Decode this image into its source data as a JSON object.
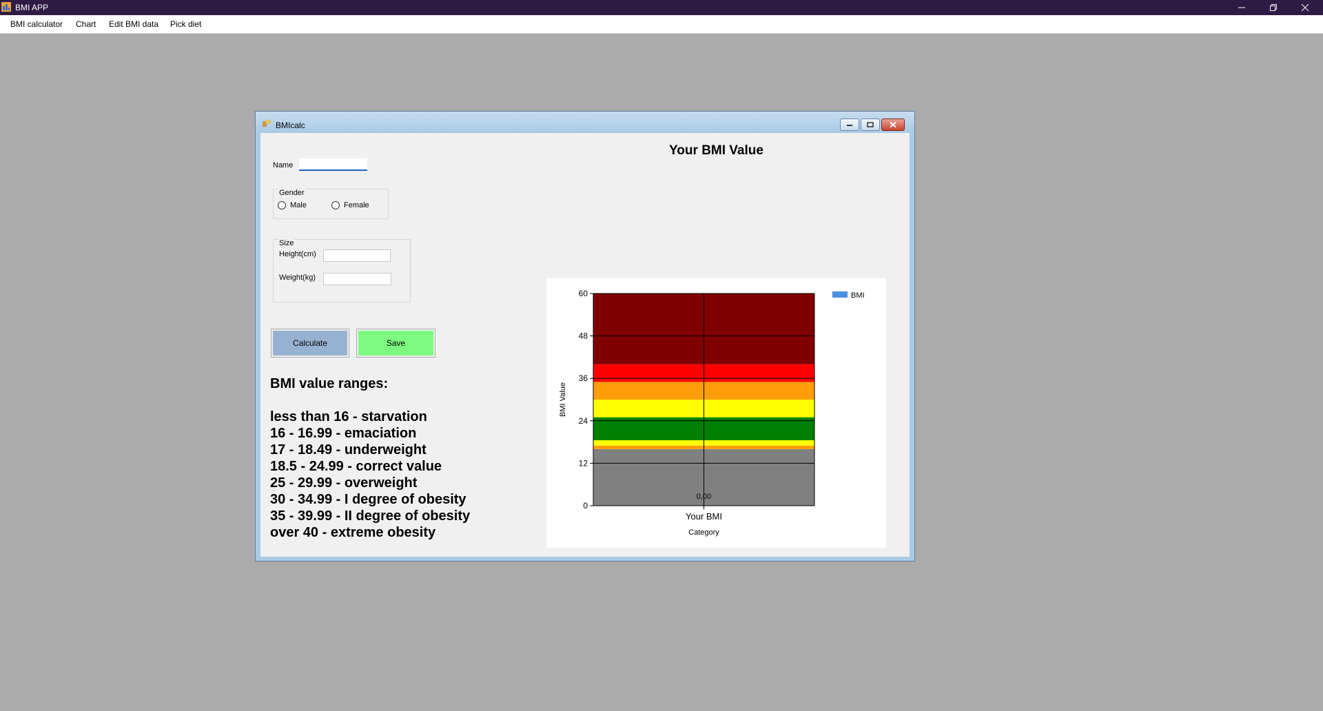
{
  "app": {
    "title": "BMI APP",
    "menu": [
      "BMI calculator",
      "Chart",
      "Edit BMI data",
      "Pick diet"
    ]
  },
  "child": {
    "title": "BMIcalc",
    "name_label": "Name",
    "name_value": "",
    "gender": {
      "title": "Gender",
      "male": "Male",
      "female": "Female"
    },
    "size": {
      "title": "Size",
      "height_label": "Height(cm)",
      "height_value": "",
      "weight_label": "Weight(kg)",
      "weight_value": ""
    },
    "calculate_label": "Calculate",
    "save_label": "Save",
    "calculate_color": "#97b1d0",
    "save_color": "#7dfb80",
    "ranges_title": "BMI value ranges:",
    "ranges": [
      "less than 16 - starvation",
      "16 - 16.99 - emaciation",
      "17 - 18.49 - underweight",
      "18.5 - 24.99 - correct value",
      "25 - 29.99 - overweight",
      "30 - 34.99 - I degree of obesity",
      "35 - 39.99 - II degree of obesity",
      "over 40 - extreme obesity"
    ],
    "chart_heading": "Your BMI Value"
  },
  "chart_data": {
    "type": "bar",
    "categories": [
      "Your BMI"
    ],
    "series": [
      {
        "name": "BMI",
        "values": [
          0
        ],
        "color": "#4a90e2"
      }
    ],
    "data_labels": [
      "0,00"
    ],
    "xlabel": "Category",
    "ylabel": "BMI Value",
    "ylim": [
      0,
      60
    ],
    "yticks": [
      0,
      12,
      24,
      36,
      48,
      60
    ],
    "grid": true,
    "legend": "top-right",
    "bands": [
      {
        "from": 0,
        "to": 16,
        "color": "#808080"
      },
      {
        "from": 16,
        "to": 17,
        "color": "#ff9e0a"
      },
      {
        "from": 17,
        "to": 18.5,
        "color": "#ffff00"
      },
      {
        "from": 18.5,
        "to": 25,
        "color": "#008000"
      },
      {
        "from": 25,
        "to": 30,
        "color": "#ffff00"
      },
      {
        "from": 30,
        "to": 35,
        "color": "#ff9e0a"
      },
      {
        "from": 35,
        "to": 40,
        "color": "#ff0000"
      },
      {
        "from": 40,
        "to": 60,
        "color": "#800000"
      }
    ]
  }
}
